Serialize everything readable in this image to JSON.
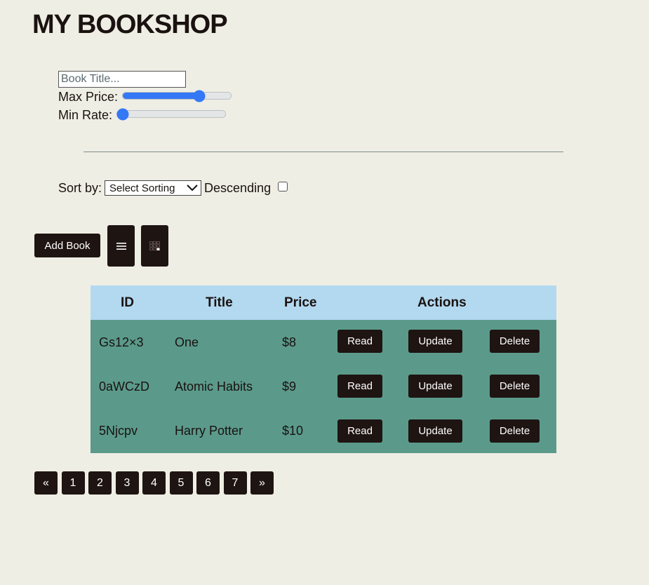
{
  "header": {
    "title": "MY BOOKSHOP"
  },
  "filters": {
    "search_placeholder": "Book Title...",
    "max_price_label": "Max Price:",
    "max_price_level": 0.73,
    "min_rate_label": "Min Rate:",
    "min_rate_level": 0.0,
    "accent_color": "#3478f6"
  },
  "sort": {
    "label": "Sort by:",
    "selected": "Select Sorting",
    "descending_label": "Descending",
    "descending_checked": false
  },
  "toolbar": {
    "add_label": "Add Book",
    "list_view_icon": "list-icon",
    "grid_view_icon": "grid-icon"
  },
  "table": {
    "headers": [
      "ID",
      "Title",
      "Price",
      "Actions"
    ],
    "rows": [
      {
        "id": "Gs12×3",
        "title": "One",
        "price": "$8"
      },
      {
        "id": "0aWCzD",
        "title": "Atomic Habits",
        "price": "$9"
      },
      {
        "id": "5Njcpv",
        "title": "Harry Potter",
        "price": "$10"
      }
    ],
    "read_label": "Read",
    "update_label": "Update",
    "delete_label": "Delete",
    "header_color": "#b2d9f0",
    "body_color": "#5b9a8b"
  },
  "pagination": {
    "prev": "«",
    "pages": [
      "1",
      "2",
      "3",
      "4",
      "5",
      "6",
      "7"
    ],
    "next": "»"
  }
}
